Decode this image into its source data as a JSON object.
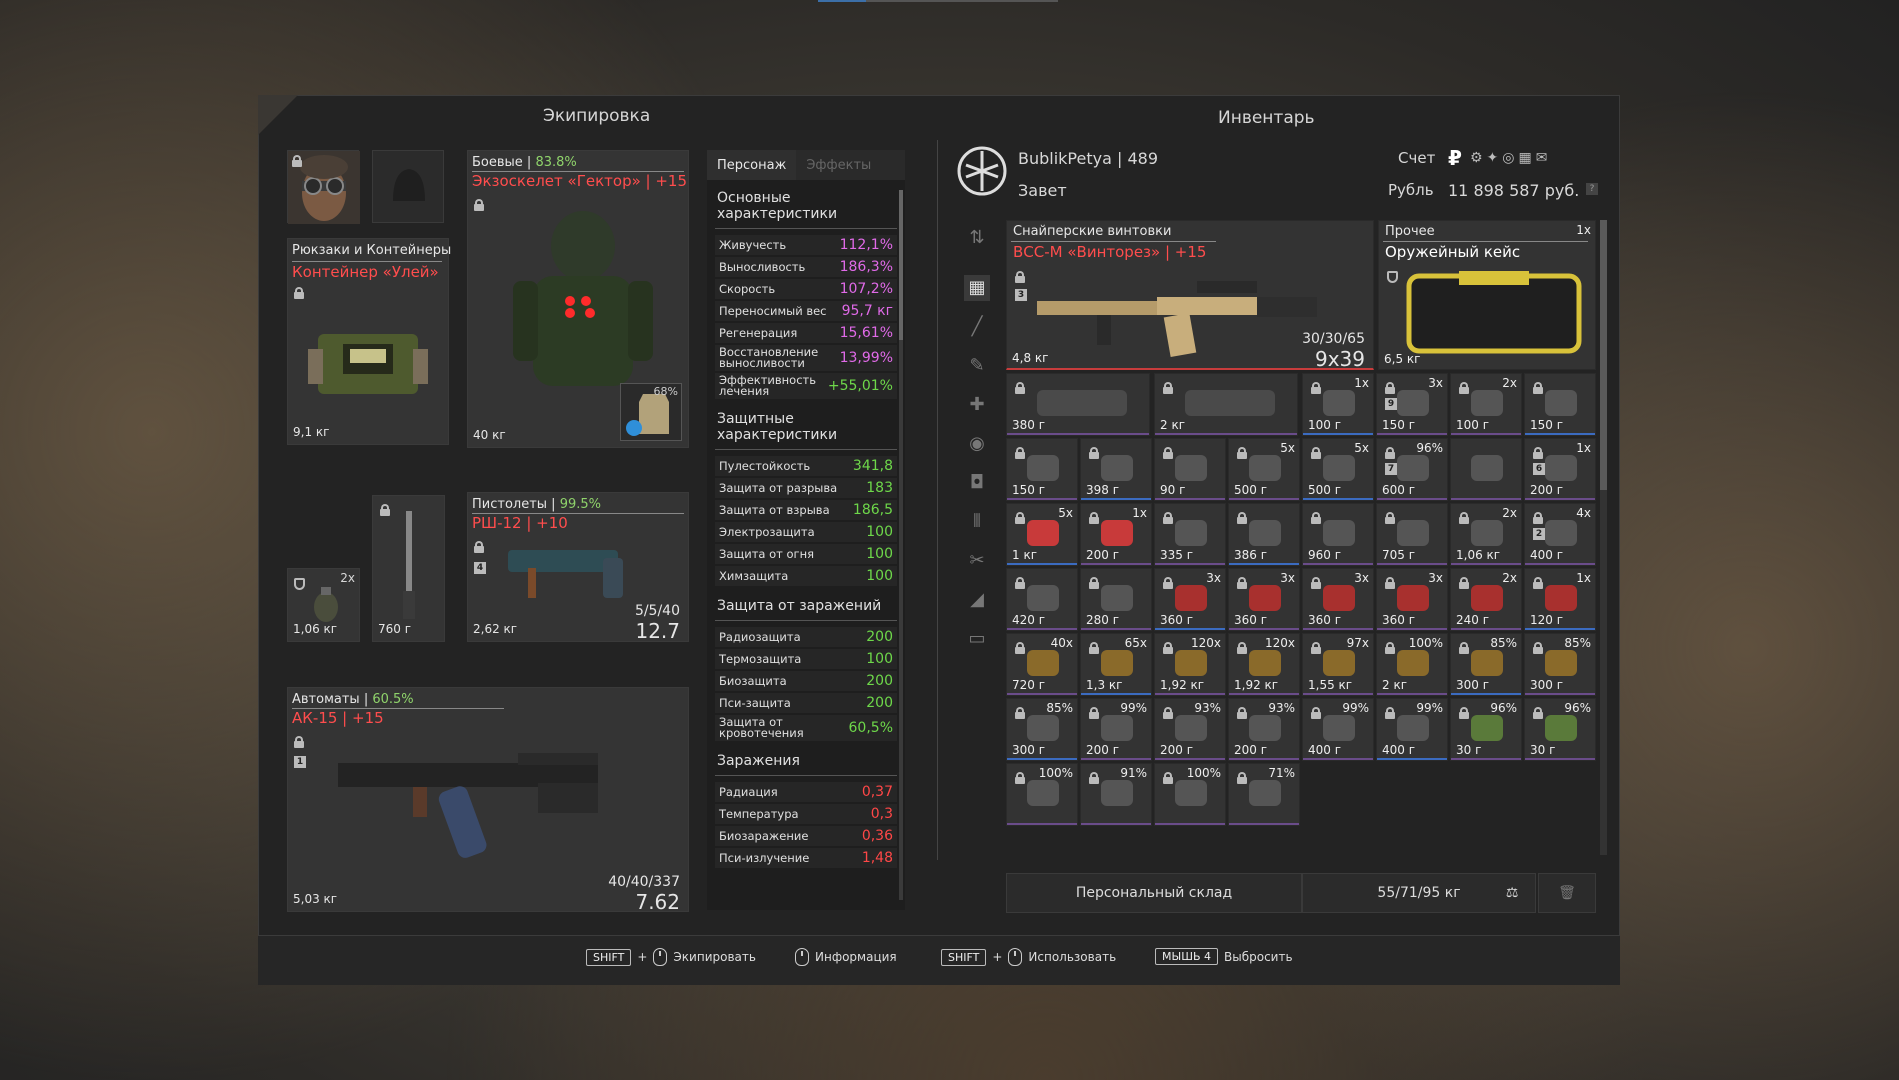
{
  "equipment": {
    "title": "Экипировка",
    "backpack": {
      "category": "Рюкзаки и Контейнеры",
      "name": "Контейнер «Улей»",
      "weight": "9,1 кг"
    },
    "armor": {
      "category": "Боевые",
      "percent": "83.8%",
      "name": "Экзоскелет «Гектор» | +15",
      "weight": "40 кг",
      "plate_percent": "68%"
    },
    "pistol": {
      "category": "Пистолеты",
      "percent": "99.5%",
      "name": "РШ-12 | +10",
      "weight": "2,62 кг",
      "ammo": "5/5/40",
      "caliber": "12.7",
      "slot_num": "4"
    },
    "grenade": {
      "count": "2x",
      "weight": "1,06 кг"
    },
    "melee": {
      "weight": "760 г"
    },
    "rifle": {
      "category": "Автоматы",
      "percent": "60.5%",
      "name": "АК-15 | +15",
      "weight": "5,03 кг",
      "ammo": "40/40/337",
      "caliber": "7.62",
      "slot_num": "1"
    }
  },
  "stats": {
    "tab_character": "Персонаж",
    "tab_effects": "Эффекты",
    "sections": [
      {
        "title": "Основные характеристики",
        "rows": [
          {
            "label": "Живучесть",
            "value": "112,1%",
            "color": "purple"
          },
          {
            "label": "Выносливость",
            "value": "186,3%",
            "color": "purple"
          },
          {
            "label": "Скорость",
            "value": "107,2%",
            "color": "purple"
          },
          {
            "label": "Переносимый вес",
            "value": "95,7 кг",
            "color": "purple"
          },
          {
            "label": "Регенерация",
            "value": "15,61%",
            "color": "purple"
          },
          {
            "label": "Восстановление выносливости",
            "value": "13,99%",
            "color": "purple"
          },
          {
            "label": "Эффективность лечения",
            "value": "+55,01%",
            "color": "green"
          }
        ]
      },
      {
        "title": "Защитные характеристики",
        "rows": [
          {
            "label": "Пулестойкость",
            "value": "341,8",
            "color": "green"
          },
          {
            "label": "Защита от разрыва",
            "value": "183",
            "color": "green"
          },
          {
            "label": "Защита от взрыва",
            "value": "186,5",
            "color": "green"
          },
          {
            "label": "Электрозащита",
            "value": "100",
            "color": "green"
          },
          {
            "label": "Защита от огня",
            "value": "100",
            "color": "green"
          },
          {
            "label": "Химзащита",
            "value": "100",
            "color": "green"
          }
        ]
      },
      {
        "title": "Защита от заражений",
        "rows": [
          {
            "label": "Радиозащита",
            "value": "200",
            "color": "green"
          },
          {
            "label": "Термозащита",
            "value": "100",
            "color": "green"
          },
          {
            "label": "Биозащита",
            "value": "200",
            "color": "green"
          },
          {
            "label": "Пси-защита",
            "value": "200",
            "color": "green"
          },
          {
            "label": "Защита от кровотечения",
            "value": "60,5%",
            "color": "green"
          }
        ]
      },
      {
        "title": "Заражения",
        "rows": [
          {
            "label": "Радиация",
            "value": "0,37",
            "color": "red"
          },
          {
            "label": "Температура",
            "value": "0,3",
            "color": "red"
          },
          {
            "label": "Биозаражение",
            "value": "0,36",
            "color": "red"
          },
          {
            "label": "Пси-излучение",
            "value": "1,48",
            "color": "red"
          }
        ]
      }
    ]
  },
  "inventory": {
    "title": "Инвентарь",
    "player": "BublikPetya | 489",
    "faction": "Завет",
    "account_label": "Счет",
    "currency_label": "Рубль",
    "balance": "11 898 587 руб.",
    "sniper": {
      "category": "Снайперские винтовки",
      "name": "ВСС-М «Винторез» | +15",
      "weight": "4,8 кг",
      "ammo": "30/30/65",
      "caliber": "9x39",
      "slot_num": "3"
    },
    "case": {
      "category": "Прочее",
      "name": "Оружейный кейс",
      "count": "1x",
      "weight": "6,5 кг"
    },
    "grid": [
      [
        "380 г",
        "",
        ""
      ],
      [
        "2 кг",
        "",
        ""
      ],
      [
        "100 г",
        "1x",
        ""
      ],
      [
        "150 г",
        "3x",
        "9"
      ],
      [
        "100 г",
        "2x",
        ""
      ],
      [
        "150 г",
        "",
        ""
      ],
      [
        "150 г",
        "",
        ""
      ],
      [
        "398 г",
        "",
        ""
      ],
      [
        "90 г",
        "",
        ""
      ],
      [
        "500 г",
        "5x",
        ""
      ],
      [
        "500 г",
        "5x",
        ""
      ],
      [
        "600 г",
        "96%",
        "7"
      ],
      [
        "",
        "",
        " "
      ],
      [
        "200 г",
        "1x",
        "6"
      ],
      [
        "1 кг",
        "5x",
        ""
      ],
      [
        "200 г",
        "1x",
        ""
      ],
      [
        "335 г",
        "",
        ""
      ],
      [
        "386 г",
        "",
        ""
      ],
      [
        "960 г",
        "",
        ""
      ],
      [
        "705 г",
        "",
        ""
      ],
      [
        "1,06 кг",
        "2x",
        ""
      ],
      [
        "400 г",
        "4x",
        "2"
      ],
      [
        "420 г",
        "",
        ""
      ],
      [
        "280 г",
        "",
        ""
      ],
      [
        "360 г",
        "3x",
        ""
      ],
      [
        "360 г",
        "3x",
        ""
      ],
      [
        "360 г",
        "3x",
        ""
      ],
      [
        "360 г",
        "3x",
        ""
      ],
      [
        "240 г",
        "2x",
        ""
      ],
      [
        "120 г",
        "1x",
        ""
      ],
      [
        "720 г",
        "40x",
        ""
      ],
      [
        "1,3 кг",
        "65x",
        ""
      ],
      [
        "1,92 кг",
        "120x",
        ""
      ],
      [
        "1,92 кг",
        "120x",
        ""
      ],
      [
        "1,55 кг",
        "97x",
        ""
      ],
      [
        "2 кг",
        "100%",
        ""
      ],
      [
        "300 г",
        "85%",
        ""
      ],
      [
        "300 г",
        "85%",
        ""
      ],
      [
        "300 г",
        "85%",
        ""
      ],
      [
        "200 г",
        "99%",
        ""
      ],
      [
        "200 г",
        "93%",
        ""
      ],
      [
        "200 г",
        "93%",
        ""
      ],
      [
        "400 г",
        "99%",
        ""
      ],
      [
        "400 г",
        "99%",
        ""
      ],
      [
        "30 г",
        "96%",
        ""
      ],
      [
        "30 г",
        "96%",
        ""
      ],
      [
        "",
        "100%",
        ""
      ],
      [
        "",
        "91%",
        ""
      ],
      [
        "",
        "100%",
        ""
      ],
      [
        "",
        "71%",
        ""
      ]
    ],
    "stash_label": "Персональный склад",
    "weight_total": "55/71/95 кг"
  },
  "hints": [
    {
      "key": "SHIFT",
      "plus": "+",
      "action": "Экипировать"
    },
    {
      "key": "",
      "plus": "",
      "action": "Информация"
    },
    {
      "key": "SHIFT",
      "plus": "+",
      "action": "Использовать"
    },
    {
      "key": "МЫШЬ 4",
      "plus": "",
      "action": "Выбросить"
    }
  ]
}
